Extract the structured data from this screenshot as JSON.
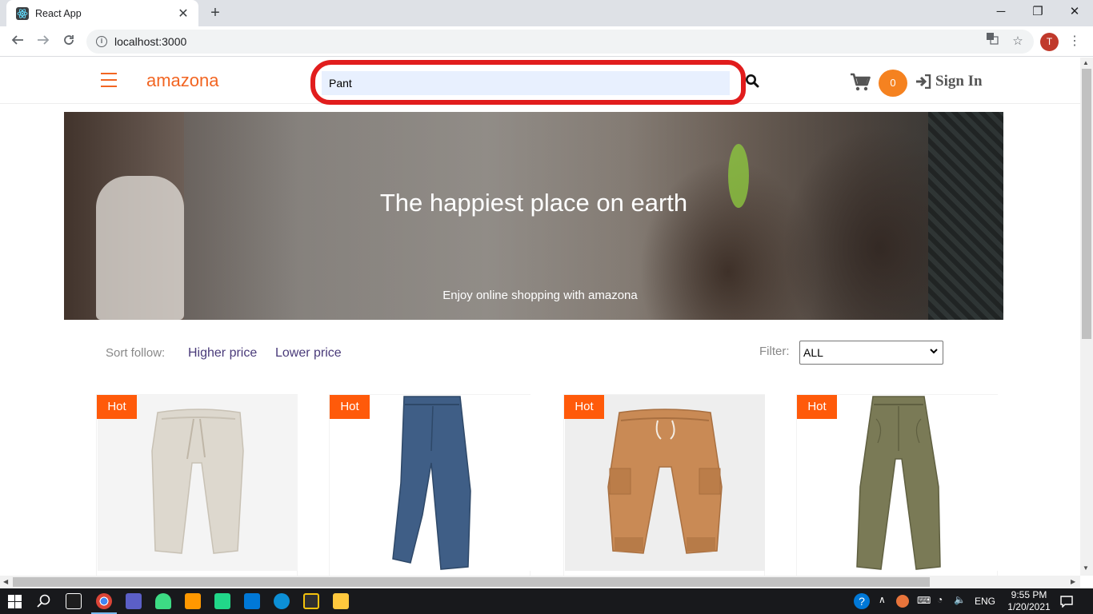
{
  "browser": {
    "tab_title": "React App",
    "tab_close": "✕",
    "new_tab": "+",
    "url": "localhost:3000",
    "profile_initial": "T",
    "window_controls": {
      "minimize": "─",
      "restore": "❐",
      "close": "✕"
    }
  },
  "header": {
    "brand": "amazona",
    "search": {
      "value": "Pant",
      "placeholder": ""
    },
    "cart_count": "0",
    "signin_label": "Sign In"
  },
  "hero": {
    "title": "The happiest place on earth",
    "subtitle": "Enjoy online shopping with amazona"
  },
  "sort": {
    "label": "Sort follow:",
    "options": [
      "Higher price",
      "Lower price"
    ]
  },
  "filter": {
    "label": "Filter:",
    "selected": "ALL"
  },
  "products": [
    {
      "badge": "Hot",
      "color": "#ddd8ce",
      "icon": "beige-pants"
    },
    {
      "badge": "Hot",
      "color": "#3f5e86",
      "icon": "blue-pants"
    },
    {
      "badge": "Hot",
      "color": "#c98a55",
      "icon": "tan-cargo-pants"
    },
    {
      "badge": "Hot",
      "color": "#7a7a56",
      "icon": "olive-pants"
    }
  ],
  "taskbar": {
    "language": "ENG",
    "time": "9:55 PM",
    "date": "1/20/2021"
  },
  "colors": {
    "brand": "#f26522",
    "badge": "#ff5a0a",
    "annotation": "#e11d1d",
    "link": "#4a3b7a"
  }
}
